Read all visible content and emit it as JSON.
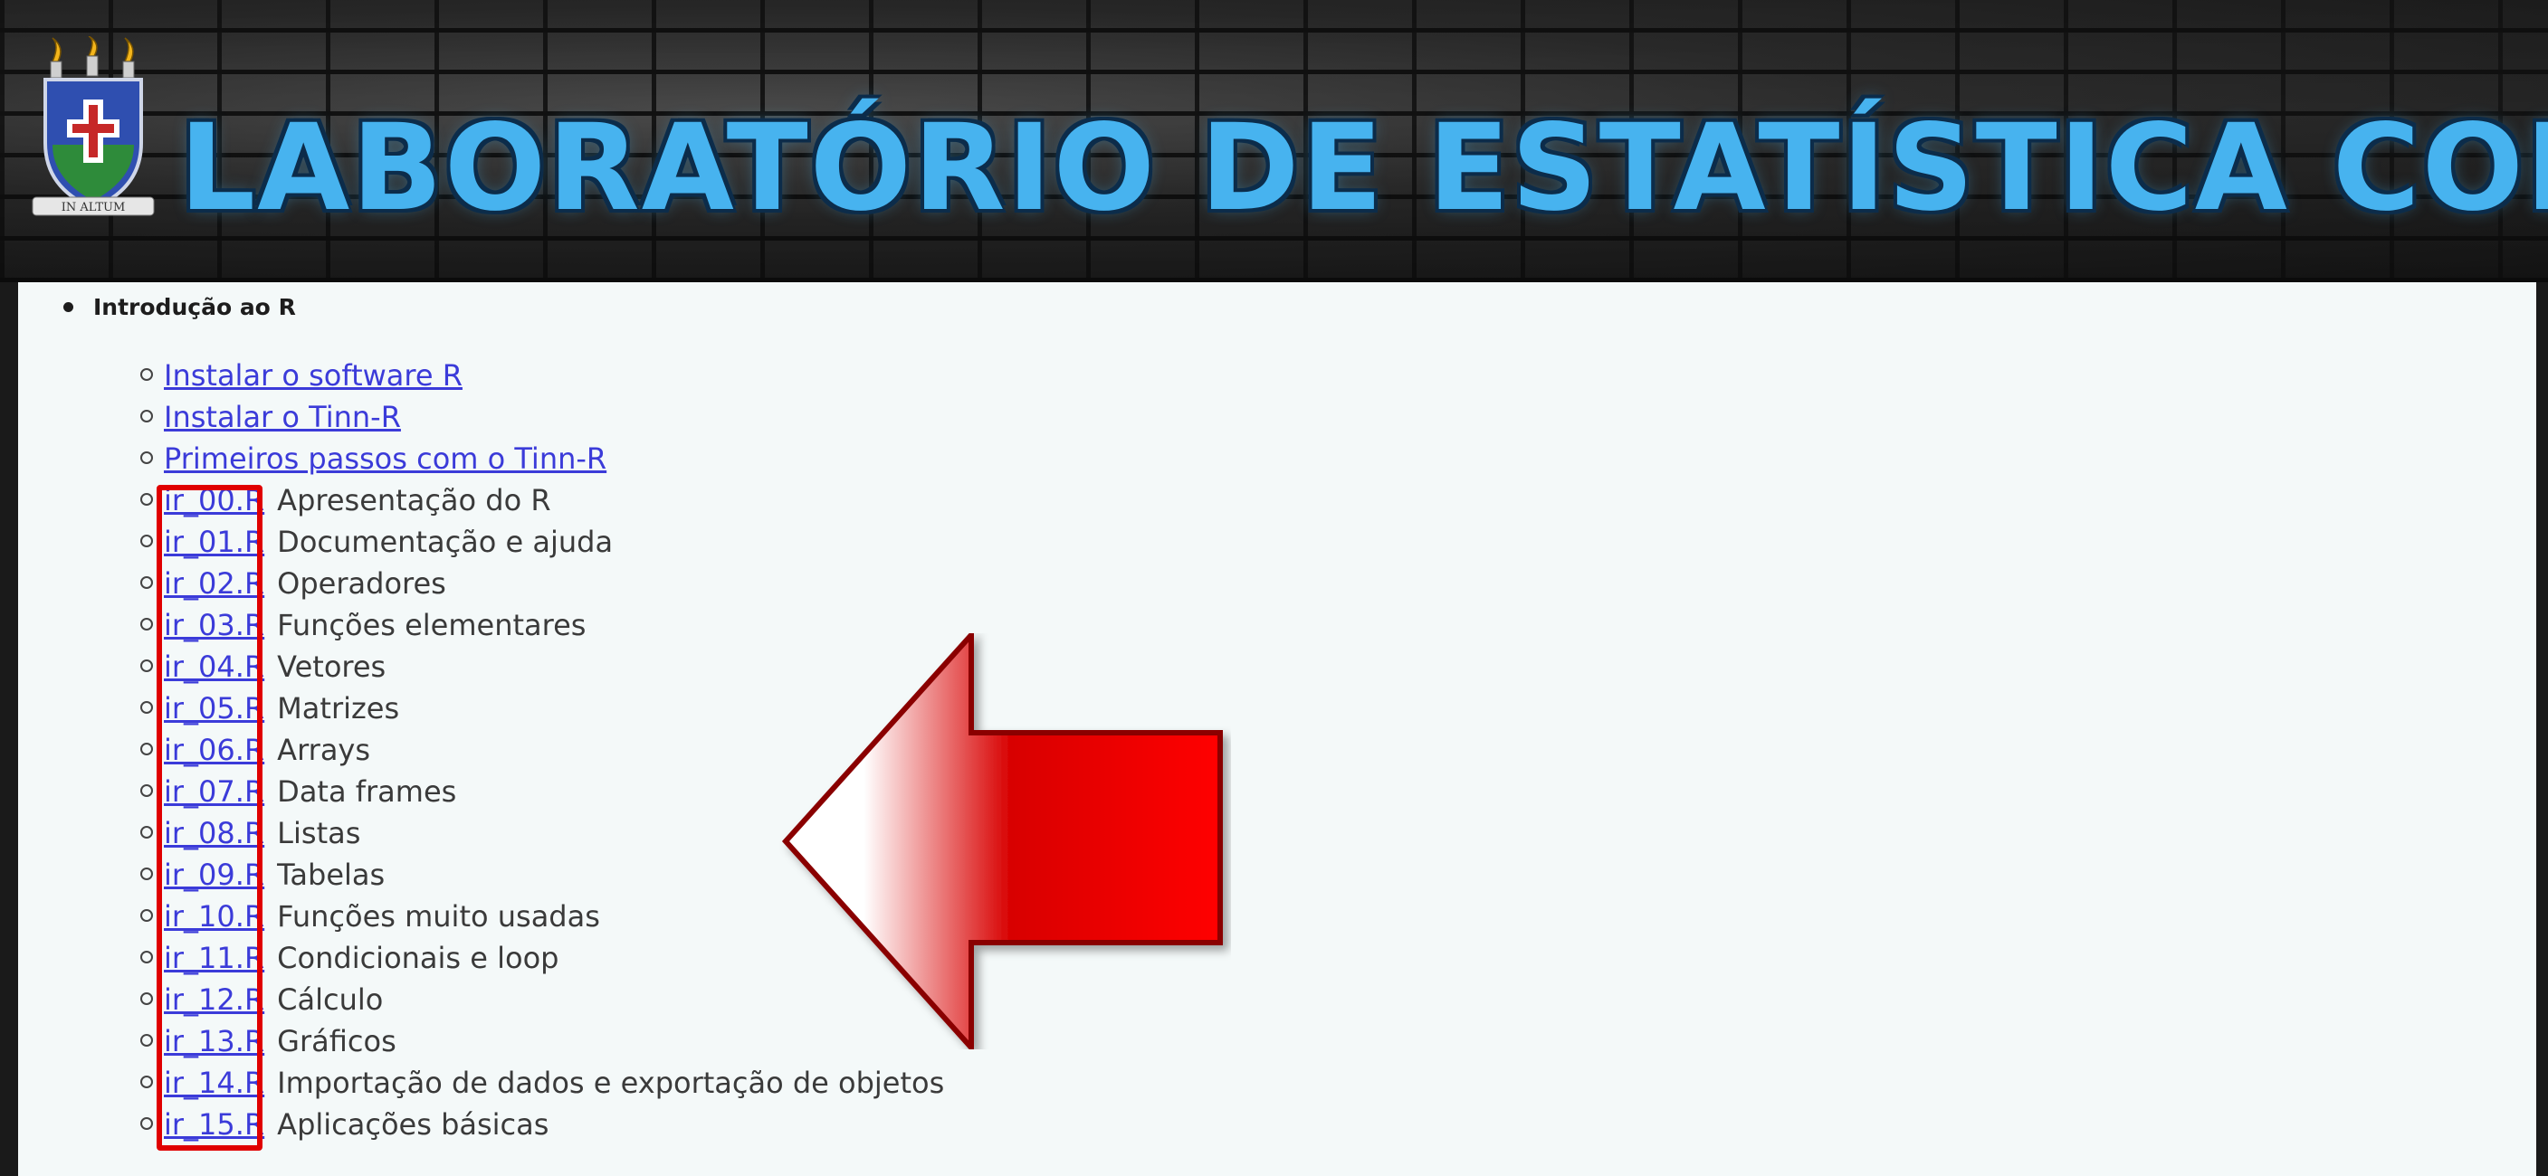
{
  "header": {
    "title": "LABORATÓRIO DE ESTATÍSTICA COMPUTACION",
    "logo_motto": "IN ALTUM",
    "logo_icon": "university-shield-icon"
  },
  "section": {
    "title": "Introdução ao R"
  },
  "links": [
    {
      "label": "Instalar o software R"
    },
    {
      "label": "Instalar o Tinn-R"
    },
    {
      "label": "Primeiros passos com o Tinn-R"
    }
  ],
  "files": [
    {
      "file": "ir_00.R",
      "desc": "Apresentação do R"
    },
    {
      "file": "ir_01.R",
      "desc": "Documentação e ajuda"
    },
    {
      "file": "ir_02.R",
      "desc": "Operadores"
    },
    {
      "file": "ir_03.R",
      "desc": "Funções elementares"
    },
    {
      "file": "ir_04.R",
      "desc": "Vetores"
    },
    {
      "file": "ir_05.R",
      "desc": "Matrizes"
    },
    {
      "file": "ir_06.R",
      "desc": "Arrays"
    },
    {
      "file": "ir_07.R",
      "desc": "Data frames"
    },
    {
      "file": "ir_08.R",
      "desc": "Listas"
    },
    {
      "file": "ir_09.R",
      "desc": "Tabelas"
    },
    {
      "file": "ir_10.R",
      "desc": "Funções muito usadas"
    },
    {
      "file": "ir_11.R",
      "desc": "Condicionais e loop"
    },
    {
      "file": "ir_12.R",
      "desc": "Cálculo"
    },
    {
      "file": "ir_13.R",
      "desc": "Gráficos"
    },
    {
      "file": "ir_14.R",
      "desc": "Importação de dados e exportação de objetos"
    },
    {
      "file": "ir_15.R",
      "desc": "Aplicações básicas"
    }
  ],
  "annotation": {
    "highlight_color": "#e00000",
    "arrow_color": "#ff0000",
    "arrow_icon": "left-arrow-icon"
  }
}
